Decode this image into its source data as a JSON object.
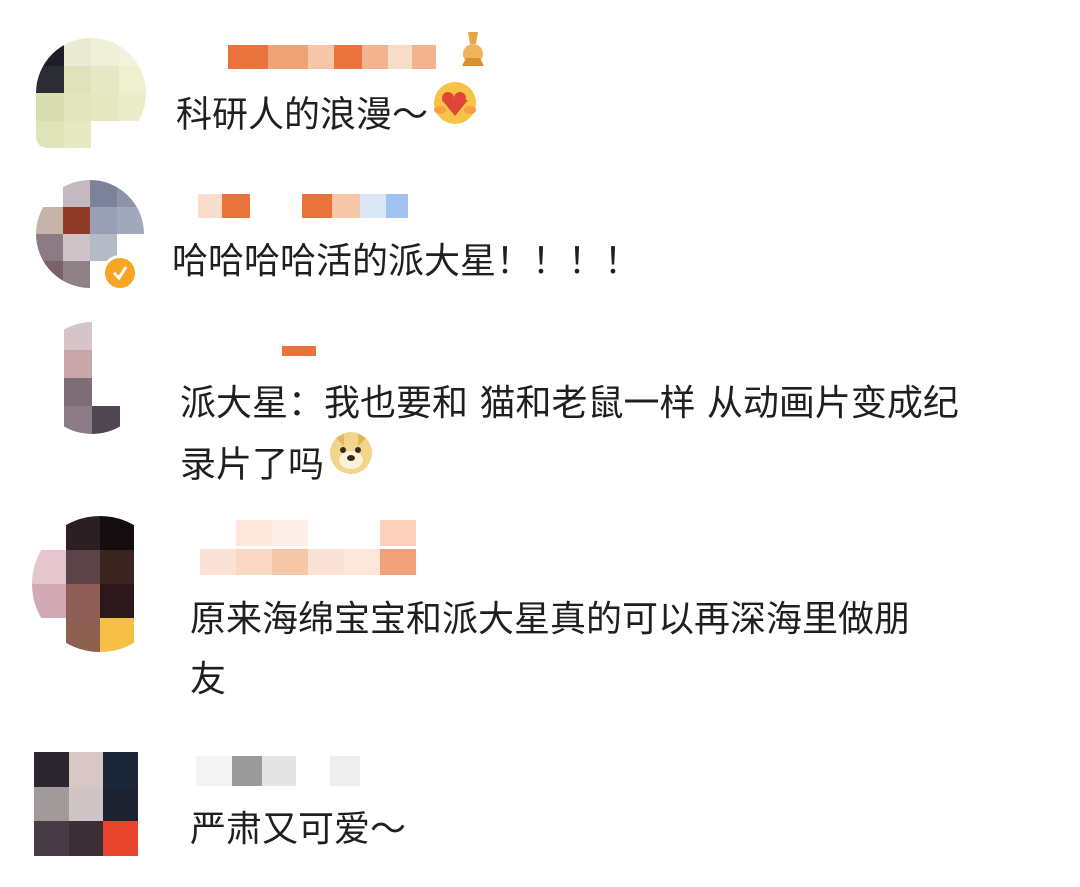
{
  "comments": [
    {
      "text": "科研人的浪漫～",
      "emoji": "heart-hug-emoji",
      "name_blurred": true,
      "has_medal": true
    },
    {
      "text": "哈哈哈哈活的派大星！！！！",
      "emoji": "",
      "name_blurred": true,
      "verified": true
    },
    {
      "text_line1": "派大星：我也要和 猫和老鼠一样 从动画片变成纪",
      "text_line2": "录片了吗",
      "emoji": "doge-emoji",
      "name_blurred": true
    },
    {
      "text_line1": "原来海绵宝宝和派大星真的可以再深海里做朋",
      "text_line2": "友",
      "name_blurred": true
    },
    {
      "text": "严肃又可爱～",
      "name_blurred": true
    }
  ],
  "colors": {
    "text": "#1f1f1f",
    "name_orange": "#e8743b",
    "verified_gold": "#f5a623"
  }
}
